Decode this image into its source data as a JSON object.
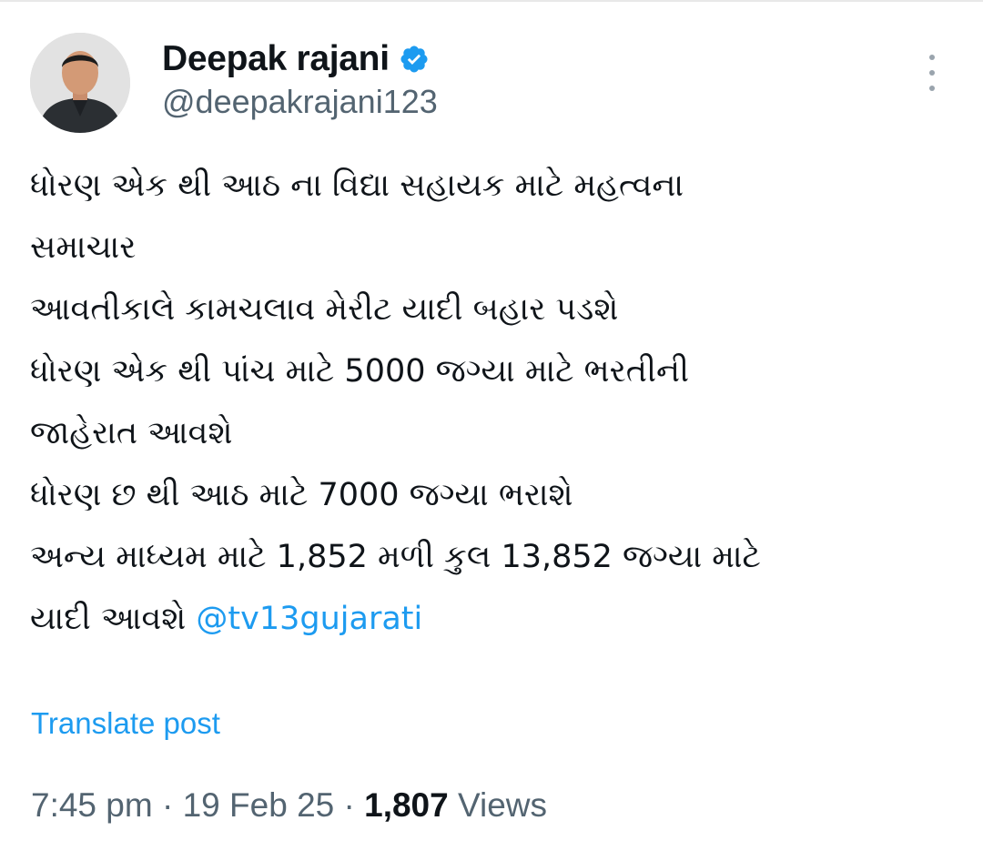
{
  "author": {
    "display_name": "Deepak rajani",
    "handle": "@deepakrajani123",
    "verified": true
  },
  "post": {
    "lines": [
      "ધોરણ એક થી આઠ ના વિદ્યા સહાયક માટે મહત્વના",
      "સમાચાર",
      "આવતીકાલે કામચલાવ મેરીટ યાદી બહાર પડશે",
      "ધોરણ એક થી પાંચ માટે 5000 જગ્યા માટે ભરતીની",
      "જાહેરાત આવશે",
      "ધોરણ છ થી આઠ માટે 7000 જગ્યા ભરાશે",
      "અન્ય માધ્યમ માટે 1,852 મળી કુલ 13,852 જગ્યા માટે"
    ],
    "last_line_text": "યાદી આવશે",
    "mention": "@tv13gujarati"
  },
  "translate_label": "Translate post",
  "meta": {
    "time": "7:45 pm",
    "date": "19 Feb 25",
    "views_count": "1,807",
    "views_label": "Views",
    "separator": "·"
  },
  "colors": {
    "accent": "#1d9bf0",
    "secondary_text": "#536471",
    "primary_text": "#0f1419"
  },
  "icons": {
    "verified": "verified-badge-icon",
    "more": "more-options-icon"
  }
}
